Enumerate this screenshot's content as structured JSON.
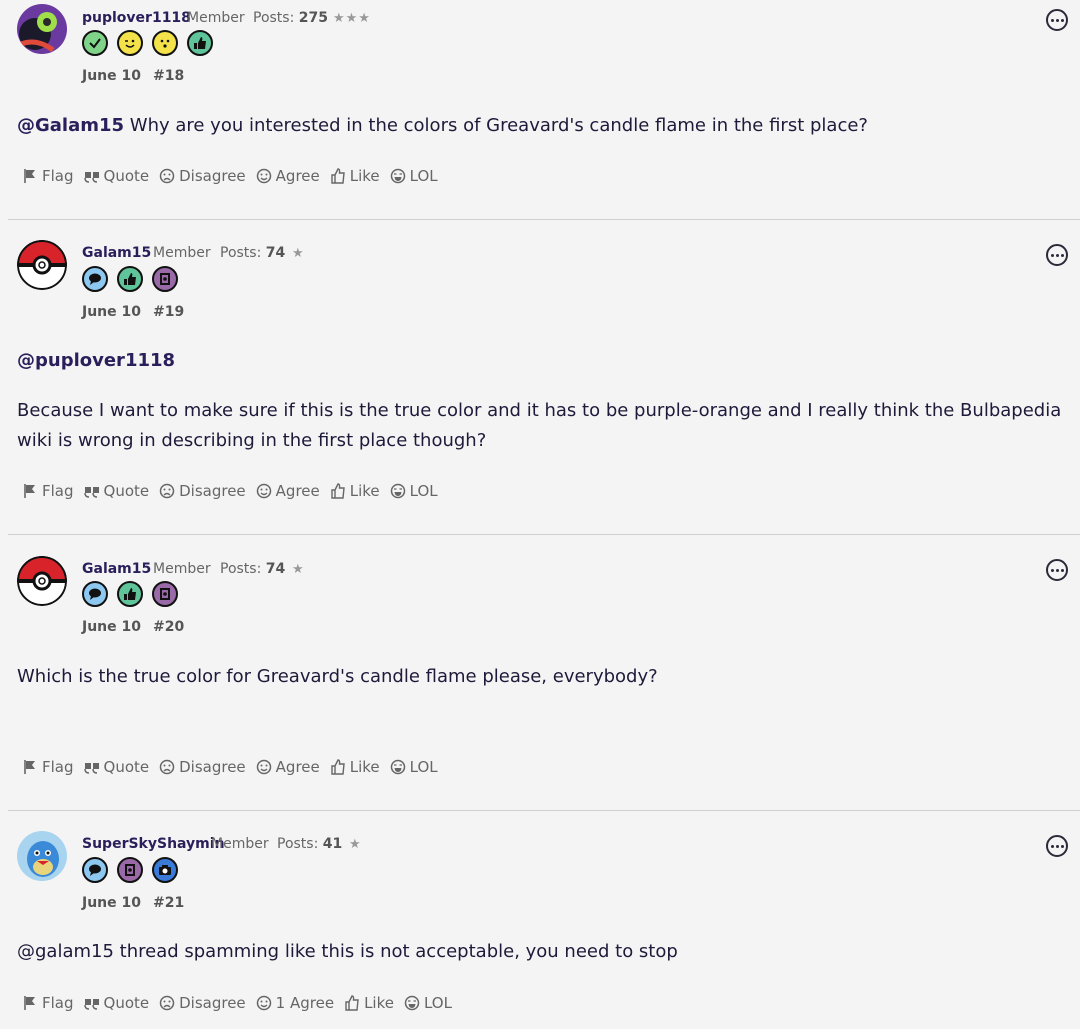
{
  "actions": {
    "flag": "Flag",
    "quote": "Quote",
    "disagree": "Disagree",
    "agree": "Agree",
    "like": "Like",
    "lol": "LOL"
  },
  "posts": [
    {
      "username": "puplover1118",
      "role": "Member",
      "posts_label": "Posts:",
      "posts_count": "275",
      "stars": "★★★",
      "date": "June 10",
      "number": "#18",
      "badges": [
        "check-badge-icon",
        "wink-badge-icon",
        "smile-badge-icon",
        "thumbs-up-badge-icon"
      ],
      "mention": "@Galam15",
      "text": " Why are you interested in the colors of Greavard's candle flame in the first place?"
    },
    {
      "username": "Galam15",
      "role": "Member",
      "posts_label": "Posts:",
      "posts_count": "74",
      "stars": "★",
      "date": "June 10",
      "number": "#19",
      "badges": [
        "speech-bubble-badge-icon",
        "thumbs-up-badge-icon",
        "notebook-badge-icon"
      ],
      "mention": "@puplover1118",
      "text": "Because I want to make sure if this is the true color and it has to be purple-orange and I really think the Bulbapedia wiki is wrong in describing in the first place though?"
    },
    {
      "username": "Galam15",
      "role": "Member",
      "posts_label": "Posts:",
      "posts_count": "74",
      "stars": "★",
      "date": "June 10",
      "number": "#20",
      "badges": [
        "speech-bubble-badge-icon",
        "thumbs-up-badge-icon",
        "notebook-badge-icon"
      ],
      "text": "Which is the true color for Greavard's candle flame please, everybody?"
    },
    {
      "username": "SuperSkyShaymin",
      "role": "Member",
      "posts_label": "Posts:",
      "posts_count": "41",
      "stars": "★",
      "date": "June 10",
      "number": "#21",
      "badges": [
        "speech-bubble-badge-icon",
        "notebook-badge-icon",
        "camera-badge-icon"
      ],
      "text": "@galam15 thread spamming like this is not acceptable, you need to stop",
      "agree_label": "1 Agree"
    }
  ],
  "colors": {
    "background": "#f4f4f4",
    "username": "#2a1f5a",
    "text": "#1f1a3a"
  }
}
